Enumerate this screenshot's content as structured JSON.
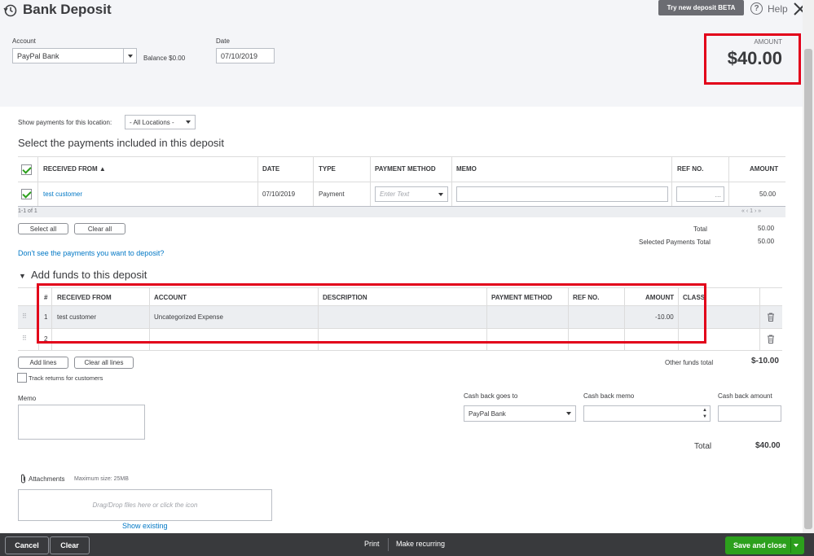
{
  "header": {
    "title": "Bank Deposit",
    "try_new": "Try new deposit BETA",
    "help": "Help"
  },
  "account": {
    "label": "Account",
    "value": "PayPal Bank",
    "balance": "Balance $0.00"
  },
  "date": {
    "label": "Date",
    "value": "07/10/2019"
  },
  "amount_box": {
    "label": "AMOUNT",
    "value": "$40.00"
  },
  "payments": {
    "location_label": "Show payments for this location:",
    "location_value": "- All Locations -",
    "section_title": "Select the payments included in this deposit",
    "columns": [
      "RECEIVED FROM ▲",
      "DATE",
      "TYPE",
      "PAYMENT METHOD",
      "MEMO",
      "REF NO.",
      "AMOUNT"
    ],
    "row": {
      "received_from": "test customer",
      "date": "07/10/2019",
      "type": "Payment",
      "method_placeholder": "Enter Text",
      "amount": "50.00"
    },
    "pagination": "1-1 of 1",
    "pager": "« ‹ 1 › »",
    "select_all": "Select all",
    "clear_all": "Clear all",
    "total_label": "Total",
    "total_value": "50.00",
    "selected_label": "Selected Payments Total",
    "selected_value": "50.00",
    "missing_link": "Don't see the payments you want to deposit?"
  },
  "funds": {
    "section_title": "Add funds to this deposit",
    "columns": [
      "#",
      "RECEIVED FROM",
      "ACCOUNT",
      "DESCRIPTION",
      "PAYMENT METHOD",
      "REF NO.",
      "AMOUNT",
      "CLASS"
    ],
    "rows": [
      {
        "num": "1",
        "received_from": "test customer",
        "account": "Uncategorized Expense",
        "amount": "-10.00"
      },
      {
        "num": "2",
        "received_from": "",
        "account": "",
        "amount": ""
      }
    ],
    "add_lines": "Add lines",
    "clear_all_lines": "Clear all lines",
    "other_total_label": "Other funds total",
    "other_total_value": "$-10.00",
    "track_returns": "Track returns for customers"
  },
  "memo": {
    "label": "Memo"
  },
  "cash_back": {
    "goes_to_label": "Cash back goes to",
    "goes_to_value": "PayPal Bank",
    "memo_label": "Cash back memo",
    "amount_label": "Cash back amount",
    "total_label": "Total",
    "total_value": "$40.00"
  },
  "attachments": {
    "label": "Attachments",
    "max_size": "Maximum size: 25MB",
    "drop_text": "Drag/Drop files here or click the icon",
    "show_existing": "Show existing"
  },
  "footer": {
    "cancel": "Cancel",
    "clear": "Clear",
    "print": "Print",
    "make_recurring": "Make recurring",
    "save_close": "Save and close"
  }
}
